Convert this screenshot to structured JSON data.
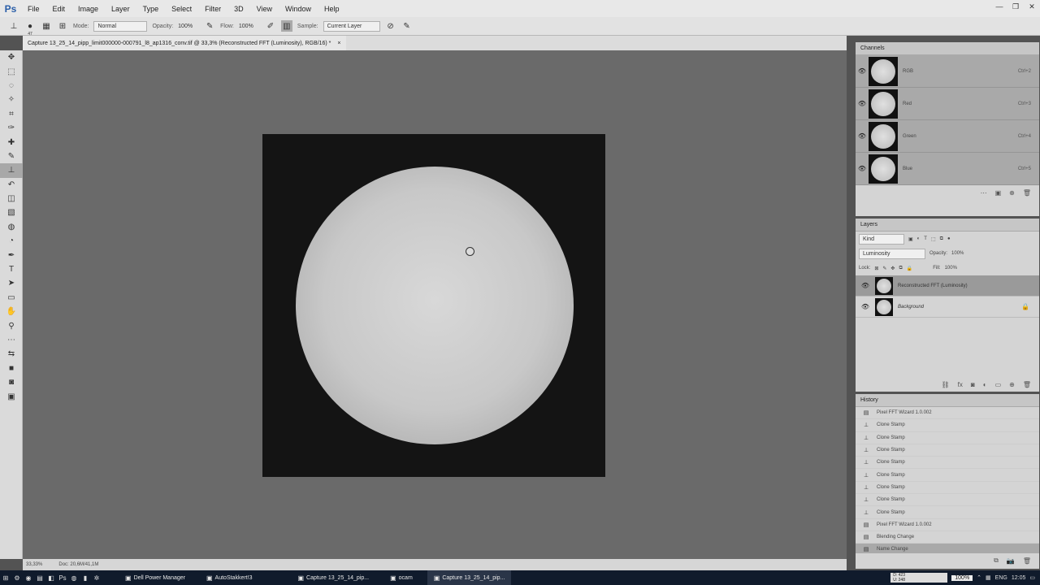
{
  "app": {
    "logo": "Ps"
  },
  "menu": [
    "File",
    "Edit",
    "Image",
    "Layer",
    "Type",
    "Select",
    "Filter",
    "3D",
    "View",
    "Window",
    "Help"
  ],
  "window_controls": [
    "—",
    "❐",
    "✕"
  ],
  "options": {
    "mode": "Normal",
    "opacity_label": "Opacity:",
    "opacity": "100%",
    "flow_label": "Flow:",
    "flow": "100%",
    "sample": "Current Layer",
    "brush_size": "47"
  },
  "document": {
    "tab_title": "Capture 13_25_14_pipp_limit000000-000791_l8_ap1316_conv.tif @ 33,3% (Reconstructed FFT (Luminosity), RGB/16) *",
    "close": "×"
  },
  "tools": [
    "move-tool",
    "marquee-tool",
    "lasso-tool",
    "magic-wand-tool",
    "crop-tool",
    "eyedropper-tool",
    "healing-tool",
    "brush-tool",
    "clone-stamp-tool",
    "history-brush-tool",
    "eraser-tool",
    "gradient-tool",
    "blur-tool",
    "dodge-tool",
    "pen-tool",
    "type-tool",
    "path-select-tool",
    "shape-tool",
    "hand-tool",
    "zoom-tool",
    "more-tool",
    "swap-colors",
    "color-swatches",
    "quickmask",
    "screen-mode"
  ],
  "status": {
    "zoom": "33,33%",
    "doc": "Doc: 20,6M/41,1M"
  },
  "channels": {
    "title": "Channels",
    "rows": [
      {
        "name": "RGB",
        "shortcut": "Ctrl+2"
      },
      {
        "name": "Red",
        "shortcut": "Ctrl+3"
      },
      {
        "name": "Green",
        "shortcut": "Ctrl+4"
      },
      {
        "name": "Blue",
        "shortcut": "Ctrl+5"
      }
    ]
  },
  "layers": {
    "title": "Layers",
    "kind": "Kind",
    "blend": "Luminosity",
    "opacity_label": "Opacity:",
    "opacity": "100%",
    "lock_label": "Lock:",
    "fill_label": "Fill:",
    "fill": "100%",
    "rows": [
      {
        "name": "Reconstructed FFT (Luminosity)"
      },
      {
        "name": "Background"
      }
    ]
  },
  "history": {
    "title": "History",
    "rows": [
      {
        "name": "Pixel FFT Wizard 1.0.002",
        "icon": "doc"
      },
      {
        "name": "Clone Stamp",
        "icon": "stamp"
      },
      {
        "name": "Clone Stamp",
        "icon": "stamp"
      },
      {
        "name": "Clone Stamp",
        "icon": "stamp"
      },
      {
        "name": "Clone Stamp",
        "icon": "stamp"
      },
      {
        "name": "Clone Stamp",
        "icon": "stamp"
      },
      {
        "name": "Clone Stamp",
        "icon": "stamp"
      },
      {
        "name": "Clone Stamp",
        "icon": "stamp"
      },
      {
        "name": "Clone Stamp",
        "icon": "stamp"
      },
      {
        "name": "Pixel FFT Wizard 1.0.002",
        "icon": "doc"
      },
      {
        "name": "Blending Change",
        "icon": "doc"
      },
      {
        "name": "Name Change",
        "icon": "doc"
      }
    ]
  },
  "taskbar": {
    "items": [
      {
        "label": "Dell Power Manager"
      },
      {
        "label": "AutoStakkert!3"
      },
      {
        "label": "Capture 13_25_14_pip..."
      },
      {
        "label": "ocam"
      },
      {
        "label": "Capture 13_25_14_pip..."
      }
    ],
    "zoom": "100%",
    "lang": "ENG",
    "time": "12:05",
    "meter": "D: 423\nU: 248"
  }
}
